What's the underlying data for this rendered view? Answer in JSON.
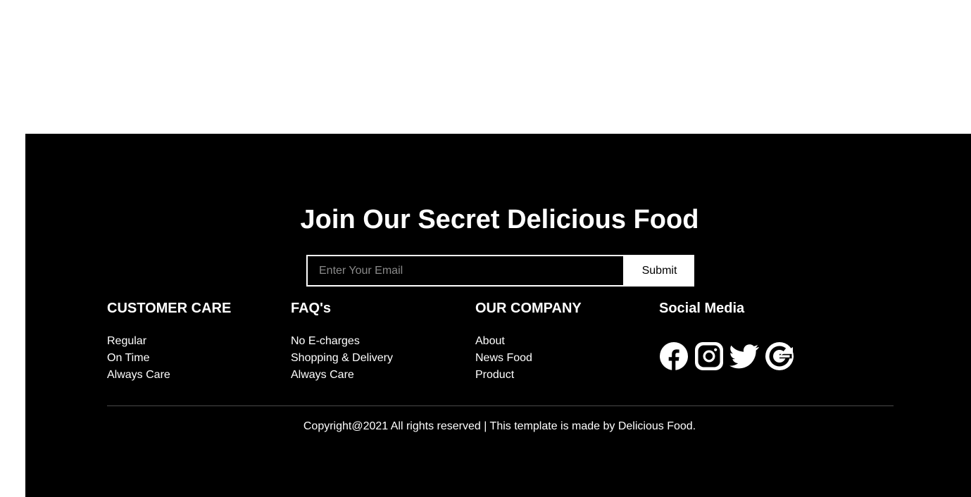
{
  "newsletter": {
    "title": "Join Our Secret Delicious Food",
    "email_placeholder": "Enter Your Email",
    "submit_label": "Submit"
  },
  "columns": [
    {
      "heading": "CUSTOMER CARE",
      "links": [
        "Regular",
        "On Time",
        "Always Care"
      ]
    },
    {
      "heading": "FAQ's",
      "links": [
        "No E-charges",
        "Shopping & Delivery",
        "Always Care"
      ]
    },
    {
      "heading": "OUR COMPANY",
      "links": [
        "About",
        "News Food",
        "Product"
      ]
    }
  ],
  "social": {
    "heading": "Social Media",
    "icons": [
      "facebook-icon",
      "instagram-icon",
      "twitter-icon",
      "google-icon"
    ]
  },
  "copyright": "Copyright@2021 All rights reserved | This template is made by Delicious Food.",
  "colors": {
    "footer_bg": "#000000",
    "text": "#ffffff",
    "page_bg": "#ffffff"
  }
}
